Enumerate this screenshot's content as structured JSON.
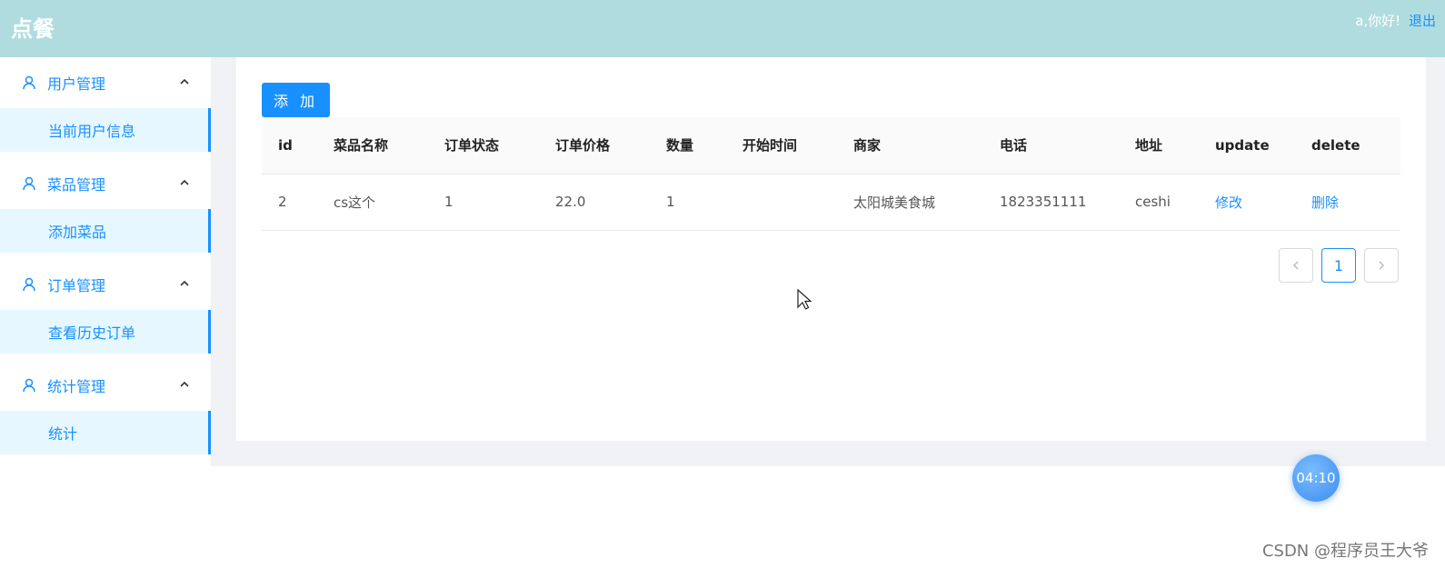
{
  "header": {
    "brand": "点餐",
    "greeting": "a,你好!",
    "logout": "退出"
  },
  "sidebar": {
    "groups": [
      {
        "title": "用户管理",
        "items": [
          "当前用户信息"
        ]
      },
      {
        "title": "菜品管理",
        "items": [
          "添加菜品"
        ]
      },
      {
        "title": "订单管理",
        "items": [
          "查看历史订单"
        ]
      },
      {
        "title": "统计管理",
        "items": [
          "统计"
        ]
      }
    ]
  },
  "toolbar": {
    "add_label": "添 加"
  },
  "table": {
    "columns": [
      "id",
      "菜品名称",
      "订单状态",
      "订单价格",
      "数量",
      "开始时间",
      "商家",
      "电话",
      "地址",
      "update",
      "delete"
    ],
    "rows": [
      [
        "2",
        "cs这个",
        "1",
        "22.0",
        "1",
        "",
        "太阳城美食城",
        "1823351111",
        "ceshi",
        "修改",
        "删除"
      ]
    ]
  },
  "pagination": {
    "prev": "<",
    "current": "1",
    "next": ">"
  },
  "timer": "04:10",
  "watermark": "CSDN @程序员王大爷",
  "colors": {
    "header_bg": "#b0dcdf",
    "accent": "#1890ff",
    "active_bg": "#e6f7ff"
  }
}
